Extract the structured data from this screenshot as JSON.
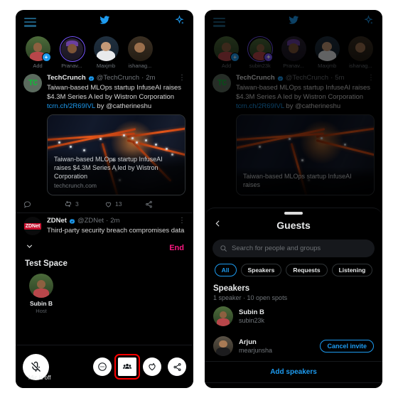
{
  "app": {
    "brand_color": "#1d9bf0",
    "end_color": "#f91880",
    "highlight_color": "#ff0000"
  },
  "left_panel": {
    "topbar": {
      "menu": "menu-icon",
      "logo": "twitter-bird-icon",
      "sparkle": "sparkle-icon"
    },
    "fleets": [
      {
        "label": "Add",
        "badge": "+",
        "badge_type": "add",
        "ring": false
      },
      {
        "label": "Pranav...",
        "badge": "",
        "badge_type": "",
        "ring": true
      },
      {
        "label": "Maxjmb",
        "badge": "",
        "badge_type": "",
        "ring": false
      },
      {
        "label": "ishanag...",
        "badge": "",
        "badge_type": "",
        "ring": false
      }
    ],
    "tweet": {
      "name": "TechCrunch",
      "handle": "@TechCrunch",
      "time": "2m",
      "text_line1": "Taiwan-based MLOps startup InfuseAI raises $4.3M",
      "text_line2": "Series A led by Wistron Corporation ",
      "link": "tcrn.ch/2R69IVL",
      "text_line3": " by @catherineshu",
      "card_title": "Taiwan-based MLOps startup InfuseAI raises $4.3M Series A led by Wistron Corporation",
      "card_domain": "techcrunch.com",
      "reply_count": "",
      "retweet_count": "3",
      "like_count": "13",
      "share": "share-icon"
    },
    "tweet2": {
      "name": "ZDNet",
      "handle": "@ZDNet",
      "time": "2m",
      "text": "Third-party security breach compromises data of"
    },
    "space": {
      "end_label": "End",
      "title": "Test Space",
      "host_name": "Subin B",
      "host_role": "Host"
    },
    "controls": {
      "mic_label": "Mic is off",
      "mic_icon": "mic-off-icon",
      "buttons": [
        {
          "icon": "emoji-reaction-icon",
          "highlighted": false
        },
        {
          "icon": "people-guests-icon",
          "highlighted": true
        },
        {
          "icon": "heart-plus-icon",
          "highlighted": false
        },
        {
          "icon": "share-icon",
          "highlighted": false
        }
      ]
    }
  },
  "right_panel": {
    "fleets": [
      {
        "label": "Add",
        "badge": "+",
        "badge_type": "add",
        "ring": false
      },
      {
        "label": "subin23k",
        "badge": "✦",
        "badge_type": "purple",
        "ring": true
      },
      {
        "label": "Pranav...",
        "badge": "",
        "badge_type": "",
        "ring": false
      },
      {
        "label": "Maxjmb",
        "badge": "",
        "badge_type": "",
        "ring": false
      },
      {
        "label": "ishanag...",
        "badge": "",
        "badge_type": "",
        "ring": false
      }
    ],
    "tweet": {
      "name": "TechCrunch",
      "handle": "@TechCrunch",
      "time": "5m",
      "text_line1": "Taiwan-based MLOps startup InfuseAI raises $4.3M",
      "text_line2": "Series A led by Wistron Corporation ",
      "link": "tcrn.ch/2R69IVL",
      "text_line3": " by @catherineshu",
      "card_title": "Taiwan-based MLOps startup InfuseAI raises"
    },
    "sheet": {
      "back": "back-chevron-icon",
      "title": "Guests",
      "search_placeholder": "Search for people and groups",
      "chips": [
        {
          "label": "All",
          "active": true
        },
        {
          "label": "Speakers",
          "active": false
        },
        {
          "label": "Requests",
          "active": false
        },
        {
          "label": "Listening",
          "active": false
        }
      ],
      "section_title": "Speakers",
      "section_sub": "1 speaker · 10 open spots",
      "people": [
        {
          "name": "Subin B",
          "handle": "subin23k",
          "action": ""
        },
        {
          "name": "Arjun",
          "handle": "mearjunsha",
          "action": "Cancel invite"
        }
      ],
      "add_speakers": "Add speakers"
    }
  }
}
